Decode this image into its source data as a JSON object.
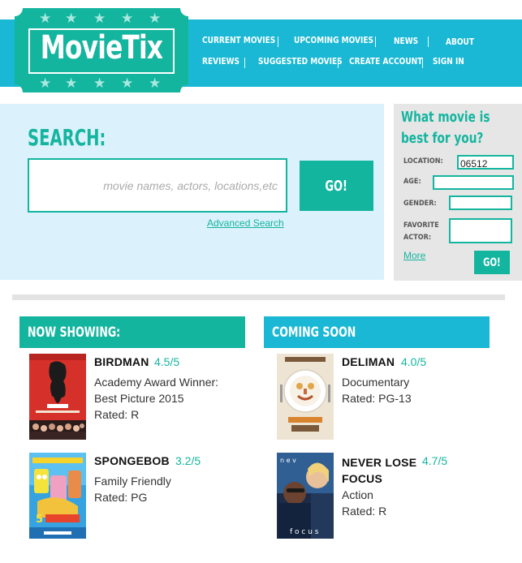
{
  "brand": {
    "name": "MovieTix"
  },
  "colors": {
    "teal": "#14b59f",
    "cyan": "#1ab8d4",
    "light_blue": "#dbf1fb",
    "panel_gray": "#e6e6e6"
  },
  "nav": {
    "current_movies": "CURRENT MOVIES",
    "upcoming_movies": "UPCOMING MOVIES",
    "news": "NEWS",
    "about": "ABOUT",
    "reviews": "REVIEWS",
    "suggested_movies": "SUGGESTED MOVIES",
    "create_account": "CREATE ACCOUNT",
    "sign_in": "SIGN IN"
  },
  "search": {
    "label": "SEARCH:",
    "placeholder": "movie names, actors, locations,etc",
    "go": "GO!",
    "advanced": "Advanced Search"
  },
  "recommend": {
    "title_line1": "What movie is",
    "title_line2": "best for you?",
    "location_label": "LOCATION:",
    "location_value": "06512",
    "age_label": "AGE:",
    "gender_label": "GENDER:",
    "favorite_label_1": "FAVORITE",
    "favorite_label_2": "ACTOR:",
    "more": "More",
    "go": "GO!"
  },
  "now_showing": {
    "heading": "NOW SHOWING:",
    "movies": [
      {
        "title": "BIRDMAN",
        "rating": "4.5/5",
        "line1": "Academy Award Winner:",
        "line2": "Best Picture 2015",
        "line3": "Rated: R",
        "poster": "birdman-poster"
      },
      {
        "title": "SPONGEBOB",
        "rating": "3.2/5",
        "line1": "Family Friendly",
        "line2": "Rated: PG",
        "poster": "spongebob-poster"
      }
    ]
  },
  "coming_soon": {
    "heading": "COMING SOON",
    "movies": [
      {
        "title": "DELIMAN",
        "rating": "4.0/5",
        "line1": "Documentary",
        "line2": "Rated: PG-13",
        "poster": "deliman-poster"
      },
      {
        "title_line1": "NEVER LOSE",
        "title_line2": "FOCUS",
        "rating": "4.7/5",
        "line1": "Action",
        "line2": "Rated: R",
        "poster": "focus-poster"
      }
    ]
  }
}
